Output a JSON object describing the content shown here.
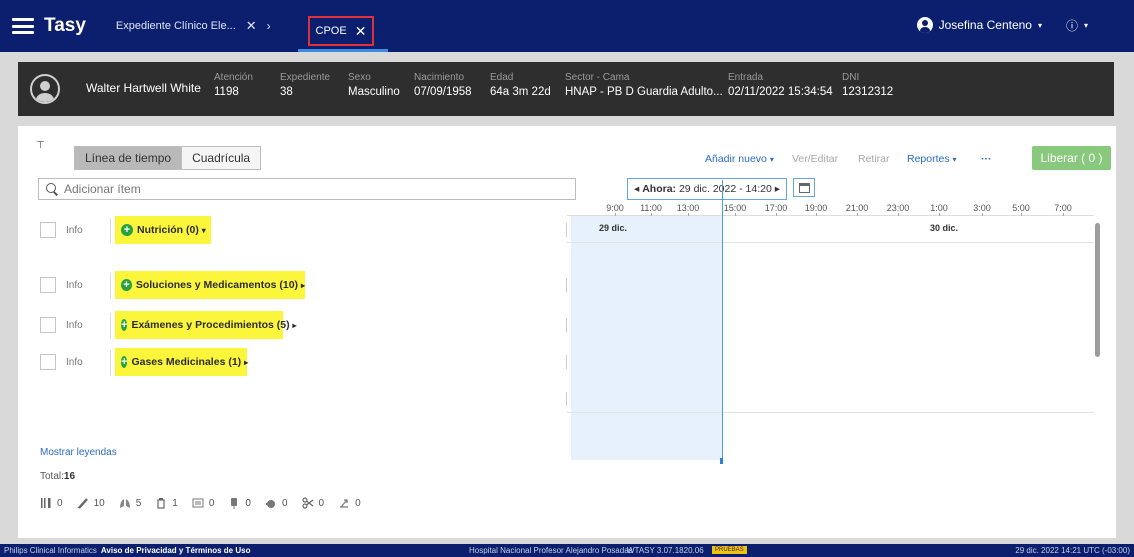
{
  "app": {
    "name": "Tasy",
    "breadcrumb": "Expediente Clínico Ele...",
    "crumb_close": "✕",
    "crumb_sep": "›",
    "active_tab": "CPOE",
    "tab_close": "✕"
  },
  "user": {
    "name": "Josefina Centeno",
    "caret": "▾",
    "info": "ⓘ",
    "info_caret": "▾"
  },
  "patient": {
    "name": "Walter Hartwell White",
    "fields": [
      {
        "label": "Atención",
        "value": "1198"
      },
      {
        "label": "Expediente",
        "value": "38"
      },
      {
        "label": "Sexo",
        "value": "Masculino"
      },
      {
        "label": "Nacimiento",
        "value": "07/09/1958"
      },
      {
        "label": "Edad",
        "value": "64a 3m 22d"
      },
      {
        "label": "Sector - Cama",
        "value": "HNAP - PB D Guardia Adulto..."
      },
      {
        "label": "Entrada",
        "value": "02/11/2022 15:34:54"
      },
      {
        "label": "DNI",
        "value": "12312312"
      }
    ]
  },
  "toolbar": {
    "filter_icon": "⊤",
    "view_timeline": "Línea de tiempo",
    "view_grid": "Cuadrícula",
    "add_new": "Añadir nuevo",
    "add_caret": "▾",
    "view_edit": "Ver/Editar",
    "remove": "Retirar",
    "reports": "Reportes",
    "reports_caret": "▾",
    "more": "···",
    "release": "Liberar ( 0 )"
  },
  "search": {
    "placeholder": "Adicionar ítem"
  },
  "groups": [
    {
      "info": "Info",
      "label": "Nutrición (0)",
      "arrow": "▾"
    },
    {
      "info": "Info",
      "label": "Soluciones y Medicamentos (10)",
      "arrow": "▸"
    },
    {
      "info": "Info",
      "label": "Exámenes y Procedimientos (5)",
      "arrow": "▸"
    },
    {
      "info": "Info",
      "label": "Gases Medicinales (1)",
      "arrow": "▸"
    }
  ],
  "timeline": {
    "prev": "◂",
    "now_label": "Ahora:",
    "now_value": "29 dic. 2022 - 14:20",
    "next": "▸",
    "hours": [
      "9:00",
      "11:00",
      "13:00",
      "15:00",
      "17:00",
      "19:00",
      "21:00",
      "23:00",
      "1:00",
      "3:00",
      "5:00",
      "7:00"
    ],
    "dates": [
      "29 dic.",
      "30 dic."
    ]
  },
  "legend": {
    "show": "Mostrar leyendas",
    "total_label": "Total:",
    "total_value": "16"
  },
  "counters": [
    {
      "icon": "cutlery-icon",
      "value": "0"
    },
    {
      "icon": "syringe-icon",
      "value": "10"
    },
    {
      "icon": "lungs-icon",
      "value": "5"
    },
    {
      "icon": "flask-icon",
      "value": "1"
    },
    {
      "icon": "monitor-icon",
      "value": "0"
    },
    {
      "icon": "blood-bag-icon",
      "value": "0"
    },
    {
      "icon": "drop-icon",
      "value": "0"
    },
    {
      "icon": "scissors-icon",
      "value": "0"
    },
    {
      "icon": "recovery-icon",
      "value": "0"
    }
  ],
  "footer": {
    "company": "Philips Clinical Informatics",
    "privacy": "Aviso de Privacidad y Términos de Uso",
    "hospital": "Hospital Nacional Profesor Alejandro Posadas",
    "version": "WTASY 3.07.1820.06",
    "env": "PRUEBAS",
    "datetime": "29 dic. 2022  14:21  UTC (-03:00)"
  },
  "colors": {
    "header": "#0c1f6e",
    "highlight": "#fbf53c",
    "accent": "#2a6cc4",
    "release": "#88c97d",
    "tab_outline": "#e0303a"
  }
}
